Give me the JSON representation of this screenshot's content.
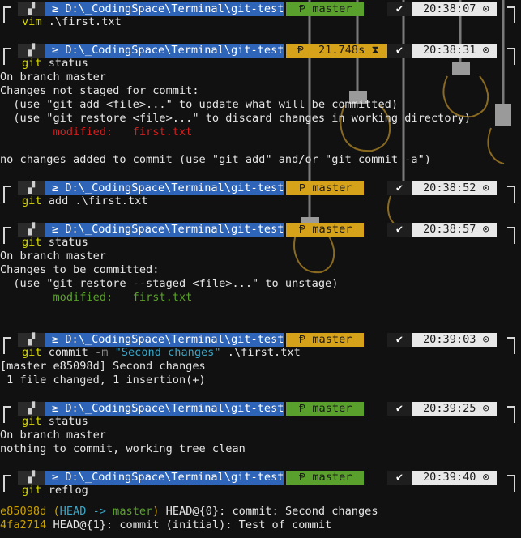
{
  "prompt": {
    "os_icon": "windows-icon",
    "folder_glyph": "≥",
    "path": "D:\\_CodingSpace\\Terminal\\git-test",
    "branch_glyph": "Ᵽ",
    "branch": "master",
    "check": "✔",
    "clock": "⊙",
    "hourglass": "⧗"
  },
  "blocks": [
    {
      "time": "20:38:07",
      "branch_color": "green",
      "cmd": "vim",
      "args": " .\\first.txt",
      "output": []
    },
    {
      "time": "20:38:31",
      "branch_color": "yellow",
      "duration": "21.748s",
      "cmd": "git",
      "args": " status",
      "output": [
        {
          "text": "On branch master",
          "color": ""
        },
        {
          "text": "Changes not staged for commit:",
          "color": ""
        },
        {
          "text": "  (use \"git add <file>...\" to update what will be committed)",
          "color": ""
        },
        {
          "text": "  (use \"git restore <file>...\" to discard changes in working directory)",
          "color": ""
        },
        {
          "text": "        modified:   first.txt",
          "color": "red"
        },
        {
          "text": "",
          "color": ""
        },
        {
          "text": "no changes added to commit (use \"git add\" and/or \"git commit -a\")",
          "color": ""
        }
      ]
    },
    {
      "time": "20:38:52",
      "branch_color": "yellow",
      "cmd": "git",
      "args": " add .\\first.txt",
      "output": []
    },
    {
      "time": "20:38:57",
      "branch_color": "yellow",
      "cmd": "git",
      "args": " status",
      "output": [
        {
          "text": "On branch master",
          "color": ""
        },
        {
          "text": "Changes to be committed:",
          "color": ""
        },
        {
          "text": "  (use \"git restore --staged <file>...\" to unstage)",
          "color": ""
        },
        {
          "text": "        modified:   first.txt",
          "color": "green"
        }
      ]
    },
    {
      "time": "20:39:03",
      "branch_color": "yellow",
      "cmd": "git",
      "args_parts": [
        " commit ",
        "-m",
        " \"Second changes\"",
        " .\\first.txt"
      ],
      "output": [
        {
          "text": "[master e85098d] Second changes",
          "color": ""
        },
        {
          "text": " 1 file changed, 1 insertion(+)",
          "color": ""
        }
      ]
    },
    {
      "time": "20:39:25",
      "branch_color": "green",
      "cmd": "git",
      "args": " status",
      "output": [
        {
          "text": "On branch master",
          "color": ""
        },
        {
          "text": "nothing to commit, working tree clean",
          "color": ""
        }
      ]
    },
    {
      "time": "20:39:40",
      "branch_color": "green",
      "cmd": "git",
      "args": " reflog",
      "output": []
    }
  ],
  "reflog": [
    {
      "hash": "e85098d",
      "ref": "(HEAD -> master)",
      "rest": " HEAD@{0}: commit: Second changes"
    },
    {
      "hash": "4fa2714",
      "ref": "",
      "rest": " HEAD@{1}: commit (initial): Test of commit"
    }
  ],
  "colors": {
    "path_bg": "#2e65b8",
    "branch_green": "#5aa02c",
    "branch_yellow": "#d6a21a",
    "time_bg": "#e8e8e8"
  }
}
